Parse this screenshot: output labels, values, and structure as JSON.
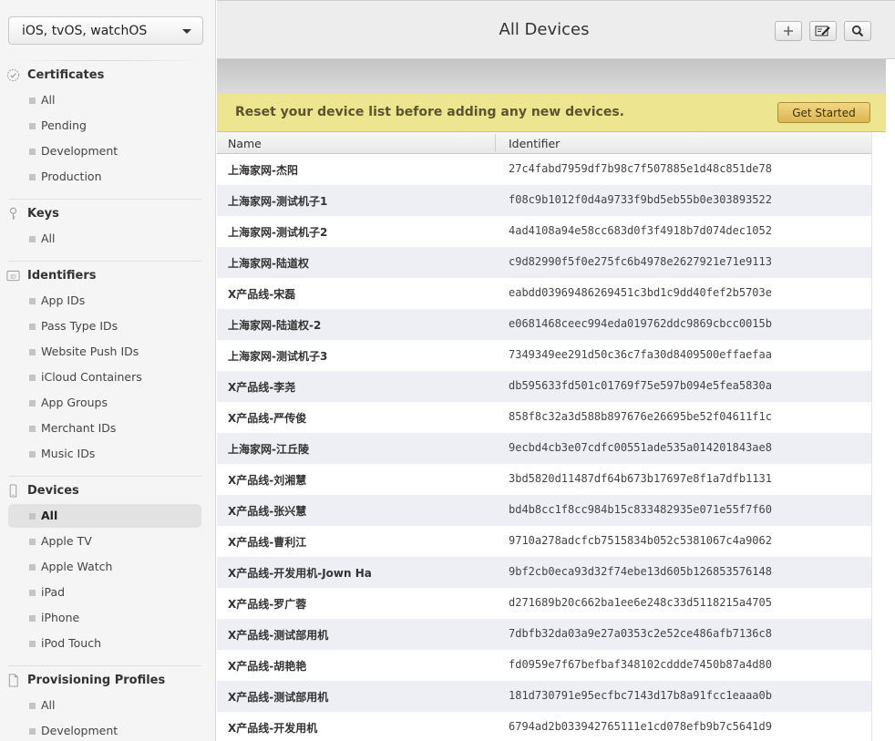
{
  "sidebar": {
    "platform": "iOS, tvOS, watchOS",
    "sections": {
      "certificates": {
        "title": "Certificates",
        "items": [
          "All",
          "Pending",
          "Development",
          "Production"
        ]
      },
      "keys": {
        "title": "Keys",
        "items": [
          "All"
        ]
      },
      "identifiers": {
        "title": "Identifiers",
        "icon_text": "ID",
        "items": [
          "App IDs",
          "Pass Type IDs",
          "Website Push IDs",
          "iCloud Containers",
          "App Groups",
          "Merchant IDs",
          "Music IDs"
        ]
      },
      "devices": {
        "title": "Devices",
        "items": [
          "All",
          "Apple TV",
          "Apple Watch",
          "iPad",
          "iPhone",
          "iPod Touch"
        ],
        "active": "All"
      },
      "provisioning": {
        "title": "Provisioning Profiles",
        "items": [
          "All",
          "Development"
        ]
      }
    }
  },
  "header": {
    "title": "All Devices",
    "buttons": [
      "add-icon",
      "edit-icon",
      "search-icon"
    ]
  },
  "banner": {
    "text": "Reset your device list before adding any new devices.",
    "button_label": "Get Started"
  },
  "table": {
    "columns": [
      "Name",
      "Identifier"
    ],
    "rows": [
      {
        "name": "上海家网-杰阳",
        "identifier": "27c4fabd7959df7b98c7f507885e1d48c851de78"
      },
      {
        "name": "上海家网-测试机子1",
        "identifier": "f08c9b1012f0d4a9733f9bd5eb55b0e303893522"
      },
      {
        "name": "上海家网-测试机子2",
        "identifier": "4ad4108a94e58cc683d0f3f4918b7d074dec1052"
      },
      {
        "name": "上海家网-陆道权",
        "identifier": "c9d82990f5f0e275fc6b4978e2627921e71e9113"
      },
      {
        "name": "X产品线-宋磊",
        "identifier": "eabdd03969486269451c3bd1c9dd40fef2b5703e"
      },
      {
        "name": "上海家网-陆道权-2",
        "identifier": "e0681468ceec994eda019762ddc9869cbcc0015b"
      },
      {
        "name": "上海家网-测试机子3",
        "identifier": "7349349ee291d50c36c7fa30d8409500effaefaa"
      },
      {
        "name": "X产品线-李尧",
        "identifier": "db595633fd501c01769f75e597b094e5fea5830a"
      },
      {
        "name": "X产品线-严传俊",
        "identifier": "858f8c32a3d588b897676e26695be52f04611f1c"
      },
      {
        "name": "上海家网-江丘陵",
        "identifier": "9ecbd4cb3e07cdfc00551ade535a014201843ae8"
      },
      {
        "name": "X产品线-刘湘慧",
        "identifier": "3bd5820d11487df64b673b17697e8f1a7dfb1131"
      },
      {
        "name": "X产品线-张兴慧",
        "identifier": "bd4b8cc1f8cc984b15c833482935e071e55f7f60"
      },
      {
        "name": "X产品线-曹利江",
        "identifier": "9710a278adcfcb7515834b052c5381067c4a9062"
      },
      {
        "name": "X产品线-开发用机-Jown Ha",
        "identifier": "9bf2cb0eca93d32f74ebe13d605b126853576148"
      },
      {
        "name": "X产品线-罗广蓉",
        "identifier": "d271689b20c662ba1ee6e248c33d5118215a4705"
      },
      {
        "name": "X产品线-测试部用机",
        "identifier": "7dbfb32da03a9e27a0353c2e52ce486afb7136c8"
      },
      {
        "name": "X产品线-胡艳艳",
        "identifier": "fd0959e7f67befbaf348102cddde7450b87a4d80"
      },
      {
        "name": "X产品线-测试部用机",
        "identifier": "181d730791e95ecfbc7143d17b8a91fcc1eaaa0b"
      },
      {
        "name": "X产品线-开发用机",
        "identifier": "6794ad2b033942765111e1cd078efb9b7c5641d9"
      }
    ]
  }
}
